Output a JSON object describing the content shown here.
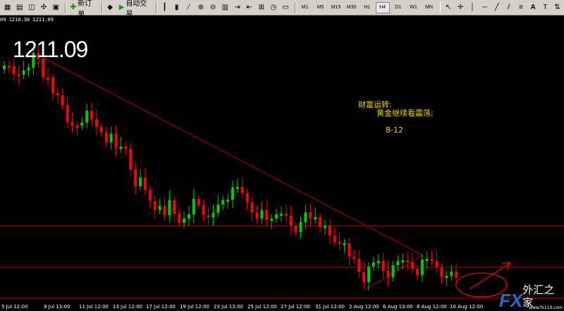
{
  "toolbar": {
    "new_order_label": "新订单",
    "auto_trading_label": "自动交易",
    "timeframes": [
      "M1",
      "M5",
      "M15",
      "M30",
      "H1",
      "H4",
      "D1",
      "W1",
      "MN"
    ],
    "active_timeframe": "H4"
  },
  "chart": {
    "ohlc_readout": "09 1210.30 1211.09",
    "big_price": "1211.09",
    "notes": {
      "title": "财富运转:",
      "subtitle": "黄金继续看震荡;",
      "date": "8-12"
    },
    "x_labels": [
      "5 Jul 12:00",
      "9 Jul 13:00",
      "11 Jul 12:00",
      "13 Jul 12:00",
      "17 Jul 12:00",
      "19 Jul 12:00",
      "23 Jul 13:00",
      "25 Jul 12:00",
      "27 Jul 12:00",
      "31 Jul 12:00",
      "2 Aug 12:00",
      "6 Aug 13:00",
      "8 Aug 12:00",
      "10 Aug 12:00"
    ],
    "colors": {
      "up": "#00cc00",
      "down": "#ff0000",
      "line": "#c00000",
      "background": "#000000"
    }
  },
  "logo": {
    "fx": "FX",
    "name": "外汇之家",
    "url": "www.fx110.com"
  }
}
